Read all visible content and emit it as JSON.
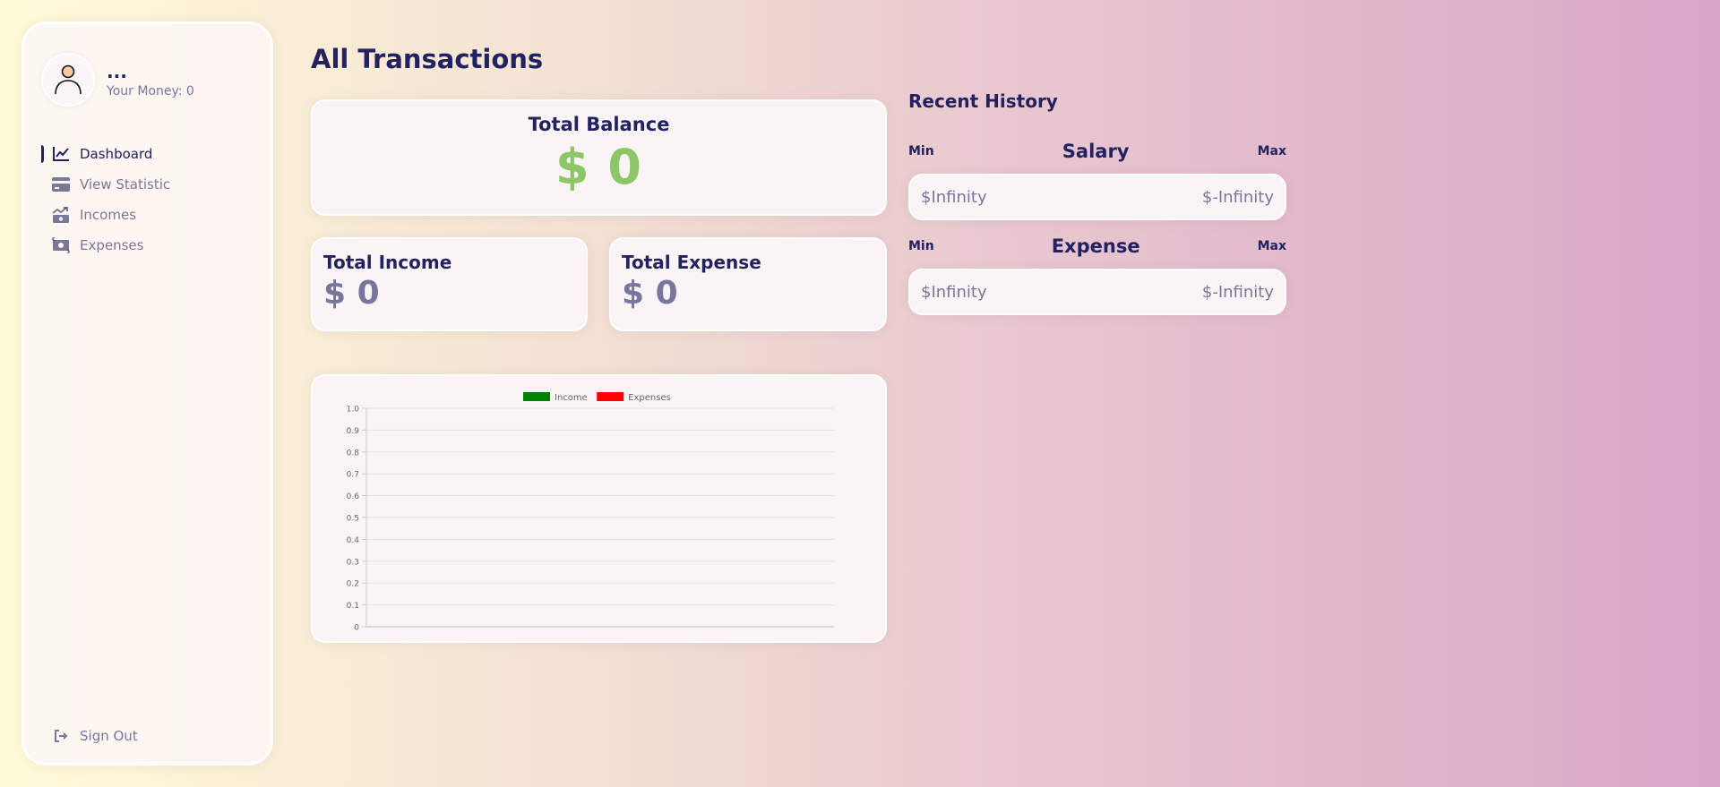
{
  "user": {
    "name": "...",
    "money_text": "Your Money: 0"
  },
  "menu": [
    {
      "label": "Dashboard",
      "icon": "chart-line-icon",
      "active": true
    },
    {
      "label": "View Statistic",
      "icon": "credit-card-icon",
      "active": false
    },
    {
      "label": "Incomes",
      "icon": "money-bill-trend-up-icon",
      "active": false
    },
    {
      "label": "Expenses",
      "icon": "money-bill-transfer-icon",
      "active": false
    }
  ],
  "signout_label": "Sign Out",
  "page_title": "All Transactions",
  "balance": {
    "label": "Total Balance",
    "value": "$ 0"
  },
  "income": {
    "label": "Total Income",
    "value": "$ 0"
  },
  "expense": {
    "label": "Total Expense",
    "value": "$ 0"
  },
  "history": {
    "title": "Recent History",
    "salary": {
      "min_label": "Min",
      "title": "Salary",
      "max_label": "Max",
      "min_value": "$Infinity",
      "max_value": "$-Infinity"
    },
    "expense": {
      "min_label": "Min",
      "title": "Expense",
      "max_label": "Max",
      "min_value": "$Infinity",
      "max_value": "$-Infinity"
    }
  },
  "colors": {
    "primary": "#222260",
    "green": "#8dc666",
    "income_series": "#008000",
    "expenses_series": "#ff0000"
  },
  "chart_data": {
    "type": "line",
    "categories": [],
    "series": [
      {
        "name": "Income",
        "values": []
      },
      {
        "name": "Expenses",
        "values": []
      }
    ],
    "ylim": [
      0,
      1
    ],
    "yticks": [
      "0",
      "0.1",
      "0.2",
      "0.3",
      "0.4",
      "0.5",
      "0.6",
      "0.7",
      "0.8",
      "0.9",
      "1.0"
    ],
    "grid": true,
    "legend": "top"
  }
}
